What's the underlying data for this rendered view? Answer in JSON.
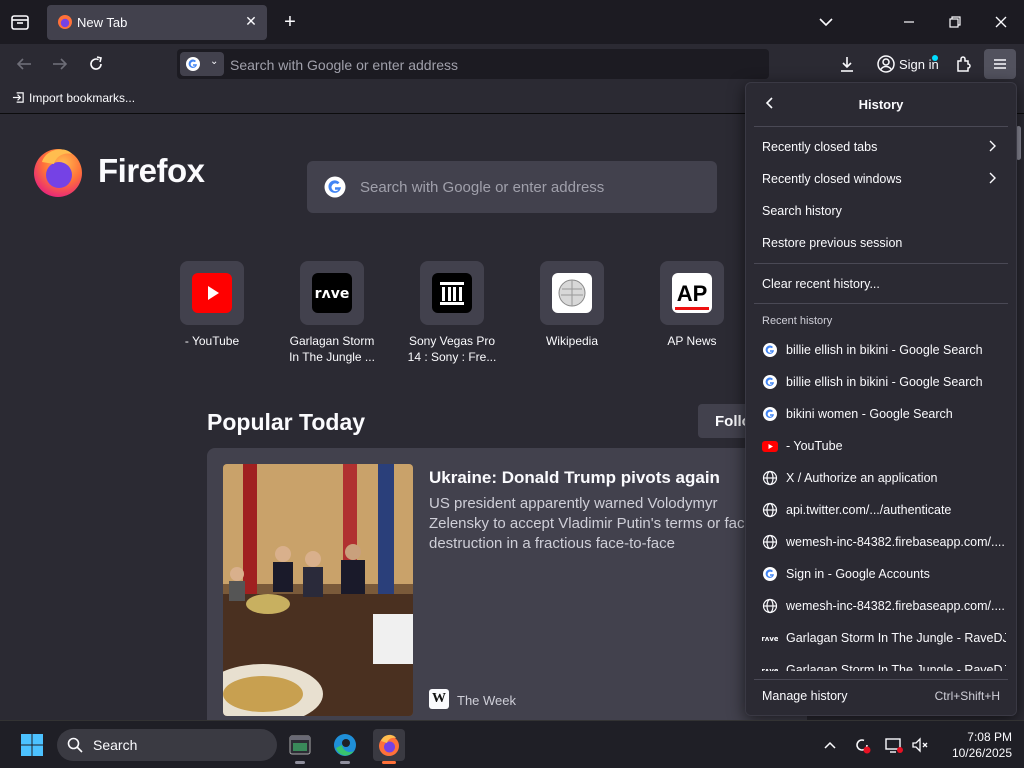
{
  "tab": {
    "title": "New Tab"
  },
  "urlbar": {
    "placeholder": "Search with Google or enter address"
  },
  "toolbar": {
    "signin_label": "Sign in"
  },
  "bookmarks": {
    "import_label": "Import bookmarks..."
  },
  "newtab": {
    "brand": "Firefox",
    "search_placeholder": "Search with Google or enter address",
    "tiles": [
      {
        "label": "- YouTube"
      },
      {
        "label": "Garlagan Storm\nIn The Jungle ..."
      },
      {
        "label": "Sony Vegas Pro\n14 : Sony : Fre..."
      },
      {
        "label": "Wikipedia"
      },
      {
        "label": "AP News"
      }
    ],
    "popular_heading": "Popular Today",
    "follow_label": "Follo",
    "story": {
      "title": "Ukraine: Donald Trump pivots again",
      "description": "US president apparently warned Volodymyr Zelensky to accept Vladimir Putin's terms or face destruction in a fractious face-to-face",
      "source": "The Week",
      "source_icon_text": "W"
    }
  },
  "history_panel": {
    "title": "History",
    "items": [
      {
        "label": "Recently closed tabs"
      },
      {
        "label": "Recently closed windows"
      },
      {
        "label": "Search history"
      },
      {
        "label": "Restore previous session"
      },
      {
        "label": "Clear recent history..."
      }
    ],
    "recent_heading": "Recent history",
    "recent": [
      {
        "label": "billie ellish in bikini - Google Search",
        "icon": "google"
      },
      {
        "label": "billie ellish in bikini - Google Search",
        "icon": "google"
      },
      {
        "label": "bikini women - Google Search",
        "icon": "google"
      },
      {
        "label": "- YouTube",
        "icon": "youtube"
      },
      {
        "label": "X / Authorize an application",
        "icon": "globe"
      },
      {
        "label": "api.twitter.com/.../authenticate",
        "icon": "globe"
      },
      {
        "label": "wemesh-inc-84382.firebaseapp.com/......",
        "icon": "globe"
      },
      {
        "label": "Sign in - Google Accounts",
        "icon": "google"
      },
      {
        "label": "wemesh-inc-84382.firebaseapp.com/......",
        "icon": "globe"
      },
      {
        "label": "Garlagan Storm In The Jungle - RaveDJ",
        "icon": "rave"
      },
      {
        "label": "Garlagan Storm In The Jungle - RaveDJ",
        "icon": "rave"
      }
    ],
    "manage_label": "Manage history",
    "manage_shortcut": "Ctrl+Shift+H"
  },
  "taskbar": {
    "search_label": "Search",
    "time": "7:08 PM",
    "date": "10/26/2025"
  }
}
